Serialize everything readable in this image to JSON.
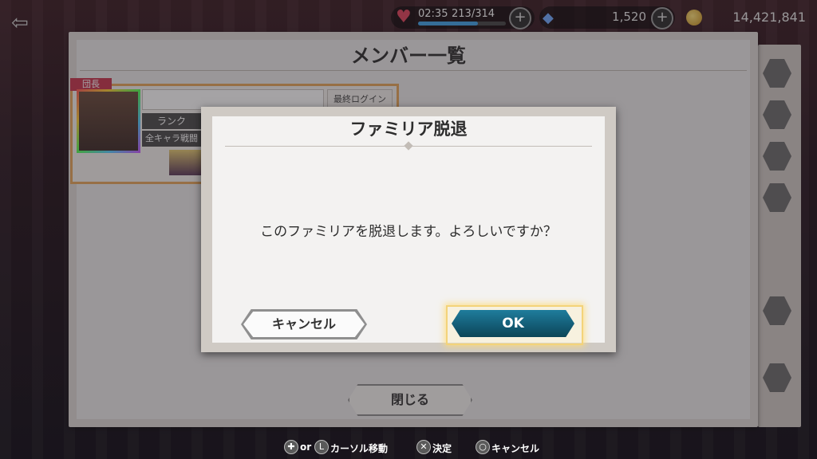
{
  "hud": {
    "stamina_time": "02:35",
    "stamina_value": "213/314",
    "stamina_fraction": 0.68,
    "gems": "1,520",
    "gold": "14,421,841"
  },
  "member_panel": {
    "title": "メンバー一覧",
    "leader_tag": "団長",
    "rank_label": "ランク",
    "battle_label": "全キャラ戦闘",
    "last_login_label": "最終ログイン",
    "close_label": "閉じる"
  },
  "dialog": {
    "title": "ファミリア脱退",
    "message": "このファミリアを脱退します。よろしいですか？",
    "cancel_label": "キャンセル",
    "ok_label": "OK"
  },
  "footer": {
    "or_label": "or",
    "cursor_label": "カーソル移動",
    "confirm_label": "決定",
    "cancel_label": "キャンセル"
  },
  "colors": {
    "ok_button": "#135a73",
    "ok_highlight": "#f3d37a",
    "leader_tag": "#c9344c",
    "card_border": "#e7a65a"
  },
  "icons": [
    "back-arrow-icon",
    "heart-icon",
    "plus-icon",
    "crystal-icon",
    "coin-icon",
    "dpad-icon",
    "stick-icon",
    "cross-button-icon",
    "circle-button-icon"
  ]
}
